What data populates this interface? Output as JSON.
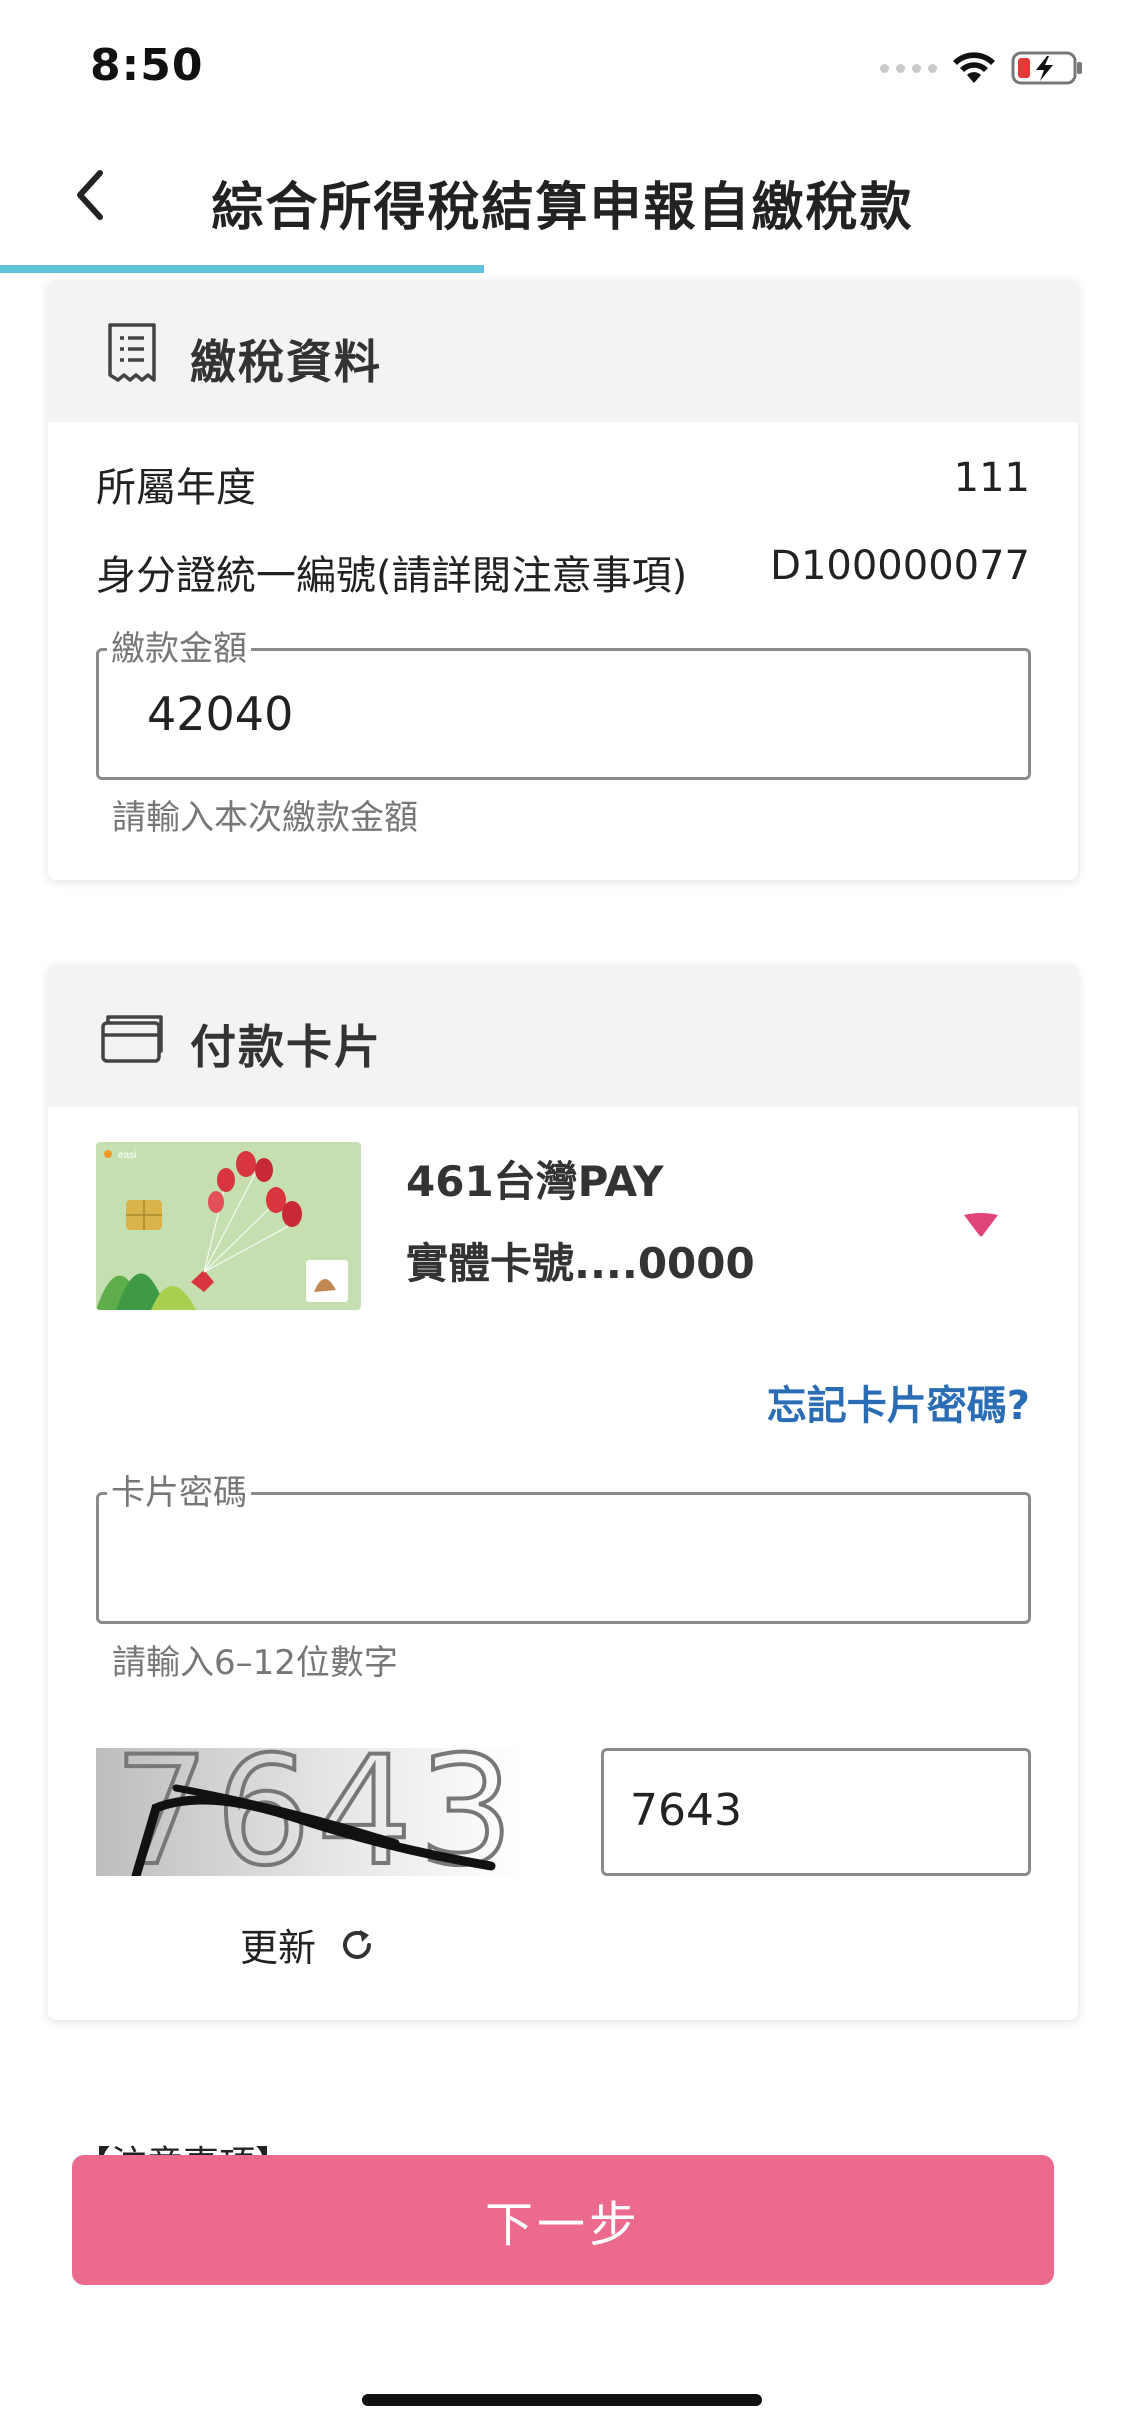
{
  "status": {
    "time": "8:50"
  },
  "header": {
    "title": "綜合所得稅結算申報自繳稅款",
    "progress": 0.43
  },
  "tax_info": {
    "section_title": "繳稅資料",
    "icon": "receipt-icon",
    "rows": [
      {
        "label": "所屬年度",
        "value": "111"
      },
      {
        "label": "身分證統一編號(請詳閱注意事項)",
        "value": "D100000077"
      }
    ],
    "amount_field": {
      "legend": "繳款金額",
      "value": "42040",
      "helper": "請輸入本次繳款金額"
    }
  },
  "payment_card": {
    "section_title": "付款卡片",
    "icon": "credit-card-icon",
    "card": {
      "name": "461台灣PAY",
      "number": "實體卡號....0000",
      "logo_text": "easi"
    },
    "forgot_link": "忘記卡片密碼?",
    "password_field": {
      "legend": "卡片密碼",
      "value": "",
      "helper": "請輸入6–12位數字"
    },
    "captcha": {
      "image_text": "7643",
      "input_value": "7643",
      "refresh_label": "更新"
    }
  },
  "notice": {
    "title": "【注意事項】"
  },
  "next_button": {
    "label": "下一步"
  },
  "colors": {
    "accent": "#5fc3dc",
    "primary_button": "#ec6a8e",
    "link": "#2a6db5",
    "dropdown": "#e0457a"
  }
}
